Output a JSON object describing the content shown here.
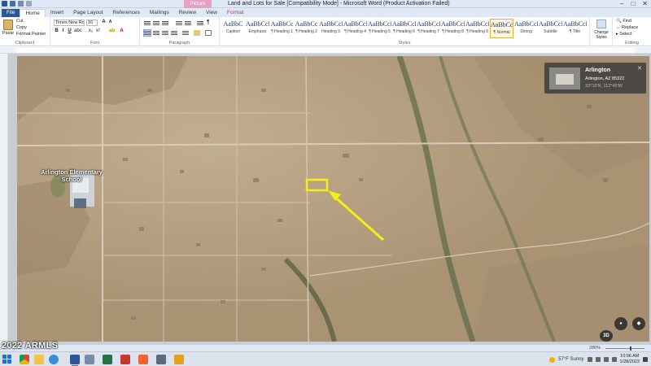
{
  "window": {
    "title": "Land and Lots for Sale [Compatibility Mode]  -  Microsoft Word (Product Activation Failed)",
    "contextual_tab_group": "Picture Tools",
    "controls": [
      "–",
      "□",
      "✕"
    ]
  },
  "tabs": [
    "File",
    "Home",
    "Insert",
    "Page Layout",
    "References",
    "Mailings",
    "Review",
    "View",
    "Format"
  ],
  "active_tab": "Home",
  "ribbon": {
    "clipboard": {
      "paste": "Paste",
      "cut": "Cut",
      "copy": "Copy",
      "format_painter": "Format Painter",
      "label": "Clipboard"
    },
    "font": {
      "name": "Times New Rom",
      "size": "10",
      "label": "Font"
    },
    "paragraph": {
      "label": "Paragraph"
    },
    "styles": {
      "label": "Styles",
      "items": [
        {
          "sample": "AaBbC",
          "name": "Caption"
        },
        {
          "sample": "AaBbCcI",
          "name": "Emphasis"
        },
        {
          "sample": "AaBbCc",
          "name": "¶ Heading 1"
        },
        {
          "sample": "AaBbCc",
          "name": "¶ Heading 2"
        },
        {
          "sample": "AaBbCcI",
          "name": "Heading 3"
        },
        {
          "sample": "AaBbCcI",
          "name": "¶ Heading 4"
        },
        {
          "sample": "AaBbCcI",
          "name": "¶ Heading 5"
        },
        {
          "sample": "AaBbCcDi",
          "name": "¶ Heading 6"
        },
        {
          "sample": "AaBbCcDi",
          "name": "¶ Heading 7"
        },
        {
          "sample": "AaBbCcDi",
          "name": "¶ Heading 8"
        },
        {
          "sample": "AaBbCcDi",
          "name": "¶ Heading 9"
        },
        {
          "sample": "AaBbCcDi",
          "name": "¶ Normal"
        },
        {
          "sample": "AaBbCcDi",
          "name": "Strong"
        },
        {
          "sample": "AaBbCcI",
          "name": "Subtitle"
        },
        {
          "sample": "AaBbCcDd",
          "name": "¶ Title"
        }
      ],
      "selected_index": 11,
      "change_styles": "Change Styles"
    },
    "editing": {
      "find": "Find",
      "replace": "Replace",
      "select": "Select",
      "label": "Editing"
    }
  },
  "map": {
    "school_label": "Arlington Elementary School",
    "card": {
      "place": "Arlington",
      "address": "Arlington, AZ 85322",
      "coords": "33°19'N, 112°45'W"
    },
    "btn_3d": "3D",
    "highlight_color": "#f3f016"
  },
  "status": {
    "zoom": "280%"
  },
  "watermark": "2022 ARMLS",
  "taskbar": {
    "weather": "57°F  Sunny",
    "time": "10:06 AM",
    "date": "1/28/2022"
  }
}
